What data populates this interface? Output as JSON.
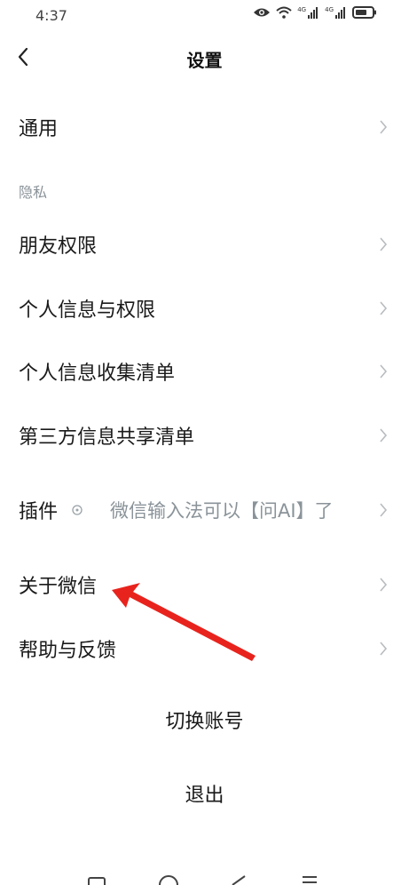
{
  "status_bar": {
    "time": "4:37",
    "icons": [
      "eye-icon",
      "wifi-icon",
      "signal-4g-icon",
      "signal-4g-icon",
      "battery-icon"
    ],
    "network_label_1": "4G",
    "network_label_2": "4G"
  },
  "header": {
    "title": "设置",
    "back_icon": "chevron-left-icon"
  },
  "menu": {
    "general": "通用",
    "privacy_section": "隐私",
    "friend_permissions": "朋友权限",
    "personal_info_permissions": "个人信息与权限",
    "personal_info_collection": "个人信息收集清单",
    "third_party_sharing": "第三方信息共享清单",
    "plugins": "插件",
    "plugins_note": "微信输入法可以【问AI】了",
    "about_wechat": "关于微信",
    "help_feedback": "帮助与反馈"
  },
  "actions": {
    "switch_account": "切换账号",
    "logout": "退出"
  },
  "annotation": {
    "color": "#e8231d"
  },
  "nav_bar": {
    "icons": [
      "square-icon",
      "circle-icon",
      "triangle-back-icon",
      "menu-icon"
    ]
  }
}
